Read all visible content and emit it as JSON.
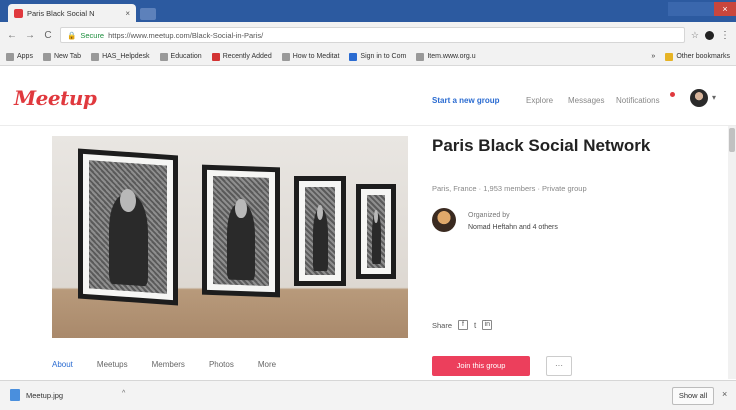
{
  "browser": {
    "tab_title": "Paris Black Social N",
    "tab_close": "×",
    "close_glyph": "×",
    "back": "←",
    "forward": "→",
    "reload": "C",
    "lock": "🔒",
    "secure_label": "Secure",
    "url": "https://www.meetup.com/Black-Social-in-Paris/",
    "star": "☆",
    "menu": "⋮",
    "bookmarks": [
      {
        "label": "Apps",
        "color": "#999999"
      },
      {
        "label": "New Tab",
        "color": "#999999"
      },
      {
        "label": "HAS_Helpdesk",
        "color": "#999999"
      },
      {
        "label": "Education",
        "color": "#999999"
      },
      {
        "label": "Recently Added",
        "color": "#d33333"
      },
      {
        "label": "How to Meditat",
        "color": "#999999"
      },
      {
        "label": "Sign in to Com",
        "color": "#2a6bd1"
      },
      {
        "label": "Item.www.org.u",
        "color": "#999999"
      }
    ],
    "bookmarks_more": "»",
    "other_bookmarks": "Other bookmarks"
  },
  "header": {
    "logo": "Meetup",
    "start_group": "Start a new group",
    "explore": "Explore",
    "messages": "Messages",
    "notifications": "Notifications",
    "caret": "▾"
  },
  "group": {
    "title": "Paris Black Social Network",
    "meta": "Paris, France · 1,953 members · Private group",
    "organized_by": "Organized by",
    "organizers": "Nomad Heftahn and 4 others",
    "share_label": "Share",
    "share_facebook": "f",
    "share_twitter": "t",
    "share_linkedin": "in",
    "tabs": [
      "About",
      "Meetups",
      "Members",
      "Photos",
      "More"
    ],
    "join_label": "Join this group",
    "more_label": "···"
  },
  "downloads": {
    "file_name": "Meetup.jpg",
    "caret": "^",
    "show_all": "Show all",
    "close": "×"
  }
}
